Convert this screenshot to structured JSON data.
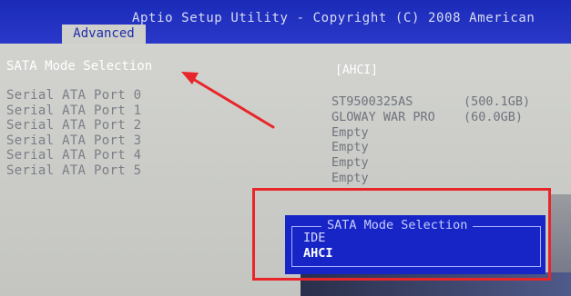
{
  "header": {
    "title": "Aptio Setup Utility - Copyright (C) 2008 American",
    "tab": "Advanced"
  },
  "setting": {
    "label": "SATA Mode Selection",
    "value": "[AHCI]"
  },
  "ports": [
    {
      "label": "Serial ATA Port 0",
      "device": "ST9500325AS",
      "capacity": "(500.1GB)"
    },
    {
      "label": "Serial ATA Port 1",
      "device": "GLOWAY WAR PRO",
      "capacity": "(60.0GB)"
    },
    {
      "label": "Serial ATA Port 2",
      "device": "Empty",
      "capacity": ""
    },
    {
      "label": "Serial ATA Port 3",
      "device": "Empty",
      "capacity": ""
    },
    {
      "label": "Serial ATA Port 4",
      "device": "Empty",
      "capacity": ""
    },
    {
      "label": "Serial ATA Port 5",
      "device": "Empty",
      "capacity": ""
    }
  ],
  "popup": {
    "title": "SATA Mode Selection",
    "options": [
      "IDE",
      "AHCI"
    ],
    "selected": "AHCI"
  },
  "annotations": {
    "arrow_icon": "red-arrow-icon",
    "highlight_color": "#e82629"
  },
  "colors": {
    "header_blue": "#1b2bb8",
    "popup_blue": "#1725c6",
    "panel_gray": "#c9cac6"
  }
}
